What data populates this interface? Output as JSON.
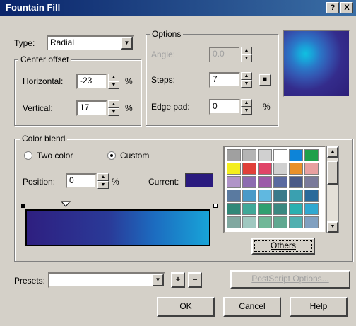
{
  "window": {
    "title": "Fountain Fill",
    "help_btn": "?",
    "close_btn": "X"
  },
  "type": {
    "label": "Type:",
    "value": "Radial"
  },
  "center_offset": {
    "legend": "Center offset",
    "horizontal_label": "Horizontal:",
    "horizontal_value": "-23",
    "vertical_label": "Vertical:",
    "vertical_value": "17",
    "unit": "%"
  },
  "options": {
    "legend": "Options",
    "angle_label": "Angle:",
    "angle_value": "0.0",
    "steps_label": "Steps:",
    "steps_value": "7",
    "edge_pad_label": "Edge pad:",
    "edge_pad_value": "0",
    "unit": "%"
  },
  "color_blend": {
    "legend": "Color blend",
    "two_color": "Two color",
    "custom": "Custom",
    "position_label": "Position:",
    "position_value": "0",
    "unit": "%",
    "current_label": "Current:",
    "current_color": "#2a1a7e",
    "gradient_start": "#2e1f80",
    "gradient_end": "#18a4d8"
  },
  "palette": {
    "colors": [
      [
        "#a0a0a0",
        "#b4b4b4",
        "#d0d0d0",
        "#ffffff",
        "#0d84d8",
        "#1ea04a"
      ],
      [
        "#f4ee1e",
        "#e0403a",
        "#e04468",
        "#d0d0d0",
        "#e8902a",
        "#e8a0a0"
      ],
      [
        "#b094c8",
        "#8c6cb0",
        "#9c5aa8",
        "#5a6aa0",
        "#4a5a88",
        "#7a7a9a"
      ],
      [
        "#5a7aa0",
        "#4a9ac8",
        "#60b8e0",
        "#3a7a8a",
        "#3aa0b0",
        "#2a6a9a"
      ],
      [
        "#308878",
        "#40a898",
        "#30a070",
        "#3a8880",
        "#2ab0b0",
        "#30a8d0"
      ],
      [
        "#80a8a0",
        "#a0c8c0",
        "#70b898",
        "#60a890",
        "#50b0b0",
        "#80a0c0"
      ]
    ],
    "others": "Others"
  },
  "presets": {
    "label": "Presets:",
    "value": "",
    "add": "+",
    "remove": "−"
  },
  "postscript": "PostScript Options...",
  "buttons": {
    "ok": "OK",
    "cancel": "Cancel",
    "help": "Help"
  }
}
